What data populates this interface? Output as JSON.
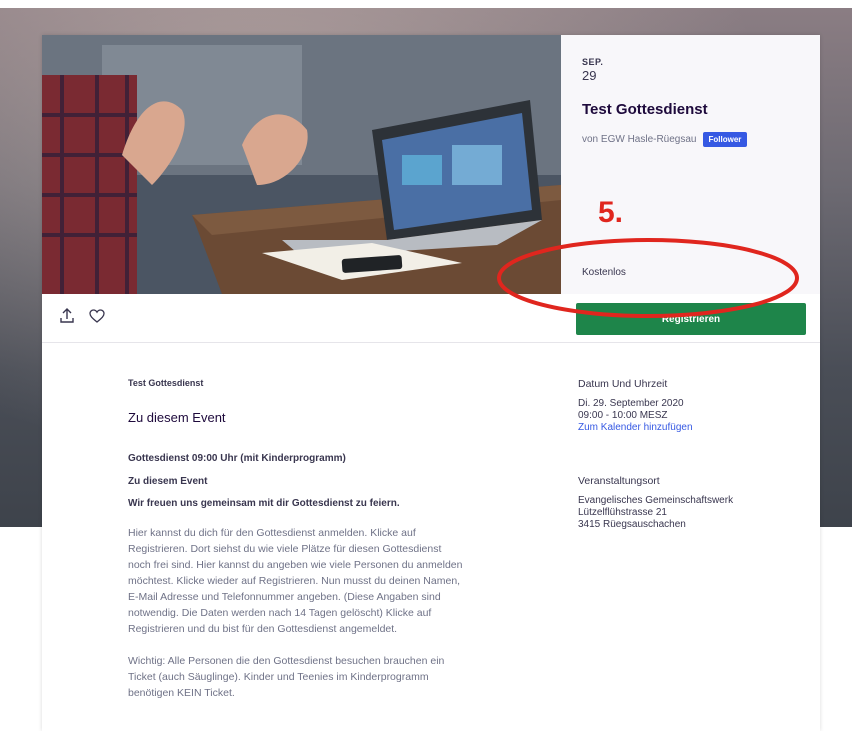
{
  "event": {
    "month": "SEP.",
    "day": "29",
    "title": "Test Gottesdienst",
    "organizer": "von EGW Hasle-Rüegsau",
    "follow_label": "Follower",
    "price": "Kostenlos",
    "register_label": "Registrieren"
  },
  "annotation": {
    "number": "5.",
    "color": "#e0261e"
  },
  "icons": {
    "share": "share-upload-icon",
    "like": "heart-icon"
  },
  "colors": {
    "register": "#1e854a",
    "follow": "#3659e3",
    "link": "#3659e3"
  },
  "main": {
    "small_title": "Test Gottesdienst",
    "about_heading": "Zu diesem Event",
    "service_line": "Gottesdienst 09:00 Uhr (mit Kinderprogramm)",
    "about_sub": "Zu diesem Event",
    "lead": "Wir freuen uns gemeinsam mit dir Gottesdienst zu feiern.",
    "paragraph1": "Hier kannst du dich für den Gottesdienst anmelden. Klicke auf\nRegistrieren. Dort siehst du wie viele Plätze für diesen Gottesdienst\nnoch frei sind. Hier kannst du angeben wie viele Personen du anmelden\nmöchtest. Klicke wieder auf Registrieren. Nun musst du deinen Namen,\nE-Mail Adresse und Telefonnummer angeben. (Diese Angaben sind\nnotwendig. Die Daten werden nach 14 Tagen gelöscht) Klicke auf\nRegistrieren und du bist für den Gottesdienst angemeldet.",
    "paragraph2": "Wichtig: Alle Personen die den Gottesdienst besuchen brauchen ein\nTicket (auch Säuglinge). Kinder und Teenies im Kinderprogramm\nbenötigen KEIN Ticket."
  },
  "aside": {
    "datetime_heading": "Datum Und Uhrzeit",
    "date": "Di. 29. September 2020",
    "time": "09:00 - 10:00 MESZ",
    "calendar_link": "Zum Kalender hinzufügen",
    "venue_heading": "Veranstaltungsort",
    "venue_name": "Evangelisches Gemeinschaftswerk",
    "venue_street": "Lützelflühstrasse 21",
    "venue_city": "3415 Rüegsauschachen"
  }
}
